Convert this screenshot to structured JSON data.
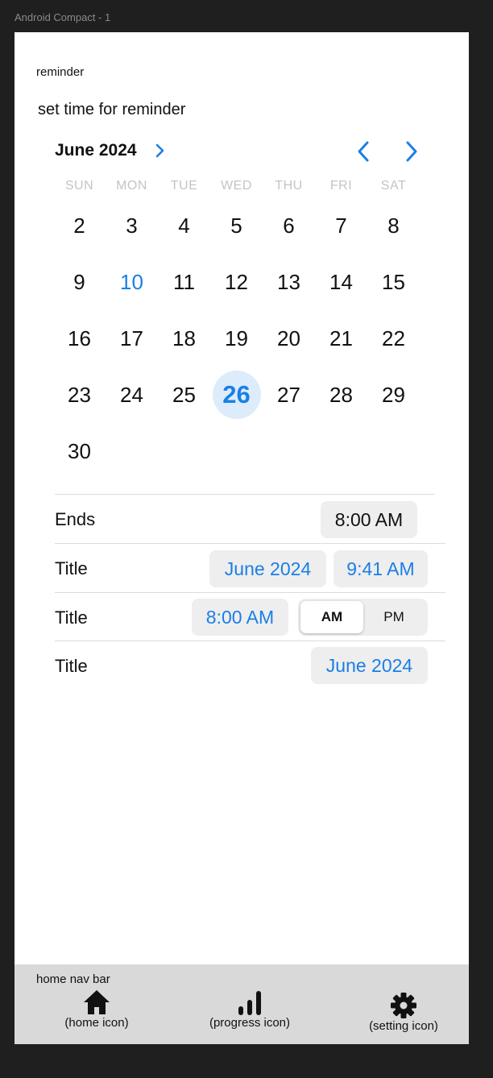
{
  "frame": {
    "label": "Android Compact - 1"
  },
  "screen": {
    "label": "reminder",
    "heading": "set time for reminder"
  },
  "calendar": {
    "month_label": "June 2024",
    "weekdays": [
      "SUN",
      "MON",
      "TUE",
      "WED",
      "THU",
      "FRI",
      "SAT"
    ],
    "days": [
      "2",
      "3",
      "4",
      "5",
      "6",
      "7",
      "8",
      "9",
      "10",
      "11",
      "12",
      "13",
      "14",
      "15",
      "16",
      "17",
      "18",
      "19",
      "20",
      "21",
      "22",
      "23",
      "24",
      "25",
      "26",
      "27",
      "28",
      "29",
      "30"
    ],
    "today": "10",
    "selected": "26",
    "icons": {
      "month_chevron": "chevron-right-icon",
      "prev": "chevron-left-icon",
      "next": "chevron-right-icon"
    }
  },
  "rows": {
    "ends": {
      "label": "Ends",
      "value": "8:00 AM"
    },
    "row2": {
      "label": "Title",
      "date": "June 2024",
      "time": "9:41 AM"
    },
    "row3": {
      "label": "Title",
      "time": "8:00 AM",
      "am": "AM",
      "pm": "PM",
      "selected_period": "AM"
    },
    "row4": {
      "label": "Title",
      "date": "June 2024"
    }
  },
  "navbar": {
    "title": "home nav bar",
    "items": [
      {
        "label": "(home icon)",
        "icon": "home-icon"
      },
      {
        "label": "(progress icon)",
        "icon": "bar-chart-icon"
      },
      {
        "label": "(setting icon)",
        "icon": "gear-icon"
      }
    ]
  },
  "colors": {
    "accent": "#1a7fe6",
    "selected_bg": "#dcecfb",
    "pill_bg": "#eeeeee",
    "navbar_bg": "#d9d9d9",
    "outer_bg": "#1f1f1f"
  }
}
